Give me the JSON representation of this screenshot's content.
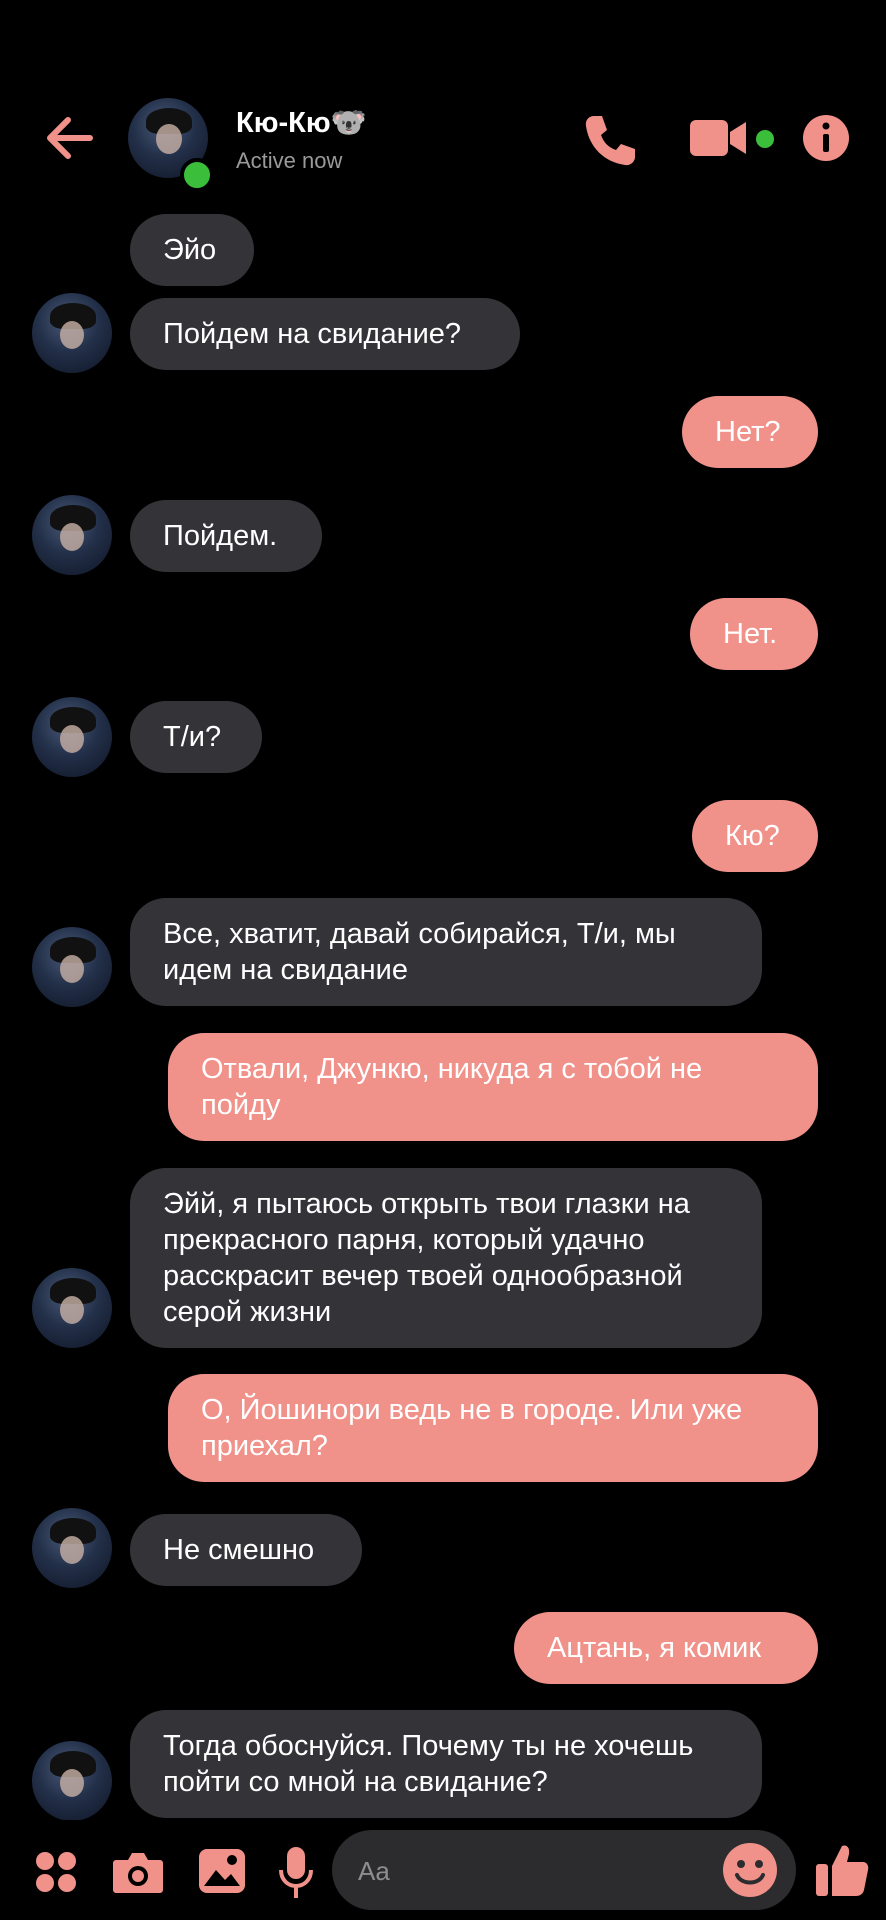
{
  "header": {
    "contact_name": "Кю-Кю🐨",
    "status": "Active now"
  },
  "colors": {
    "accent": "#f0918a",
    "incoming": "#343338",
    "online": "#3bbf3b",
    "background": "#000000"
  },
  "icons": [
    "back-arrow-icon",
    "phone-icon",
    "video-camera-icon",
    "info-icon",
    "apps-icon",
    "camera-icon",
    "gallery-icon",
    "microphone-icon",
    "emoji-icon",
    "thumbs-up-icon"
  ],
  "messages": [
    {
      "side": "in",
      "text": "Эйо"
    },
    {
      "side": "in",
      "text": "Пойдем на свидание?"
    },
    {
      "side": "out",
      "text": "Нет?"
    },
    {
      "side": "in",
      "text": "Пойдем."
    },
    {
      "side": "out",
      "text": "Нет."
    },
    {
      "side": "in",
      "text": "Т/и?"
    },
    {
      "side": "out",
      "text": "Кю?"
    },
    {
      "side": "in",
      "text": "Все, хватит, давай собирайся, Т/и, мы идем на свидание"
    },
    {
      "side": "out",
      "text": "Отвали, Джункю, никуда я с тобой не пойду"
    },
    {
      "side": "in",
      "text": "Эйй, я пытаюсь открыть твои глазки на прекрасного парня, который удачно расскрасит вечер твоей однообразной серой жизни"
    },
    {
      "side": "out",
      "text": "О, Йошинори ведь не в городе. Или уже приехал?"
    },
    {
      "side": "in",
      "text": "Не смешно"
    },
    {
      "side": "out",
      "text": "Ацтань, я комик"
    },
    {
      "side": "in",
      "text": "Тогда обоснуйся. Почему ты не хочешь пойти со мной на свидание?"
    }
  ],
  "composer": {
    "placeholder": "Aa"
  }
}
